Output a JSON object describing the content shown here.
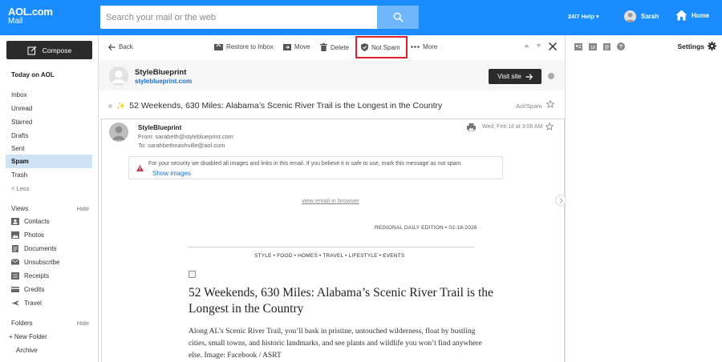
{
  "brand": {
    "logo_main": "AOL.com",
    "logo_sub": "Mail"
  },
  "search": {
    "placeholder": "Search your mail or the web"
  },
  "header": {
    "help": "24/7 Help ▾",
    "user_name": "Sarah",
    "home": "Home"
  },
  "sidebar": {
    "compose": "Compose",
    "today": "Today on AOL",
    "folders": [
      {
        "label": "Inbox",
        "active": false
      },
      {
        "label": "Unread",
        "active": false
      },
      {
        "label": "Starred",
        "active": false
      },
      {
        "label": "Drafts",
        "active": false
      },
      {
        "label": "Sent",
        "active": false
      },
      {
        "label": "Spam",
        "active": true
      },
      {
        "label": "Trash",
        "active": false
      }
    ],
    "less": "˄ Less",
    "views_head": "Views",
    "views_hide": "Hide",
    "views": [
      {
        "label": "Contacts",
        "icon": "contacts-icon"
      },
      {
        "label": "Photos",
        "icon": "photos-icon"
      },
      {
        "label": "Documents",
        "icon": "documents-icon"
      },
      {
        "label": "Unsubscribe",
        "icon": "unsubscribe-icon"
      },
      {
        "label": "Receipts",
        "icon": "receipts-icon"
      },
      {
        "label": "Credits",
        "icon": "credits-icon"
      },
      {
        "label": "Travel",
        "icon": "travel-icon"
      }
    ],
    "folders_head": "Folders",
    "folders_hide": "Hide",
    "new_folder": "+ New Folder",
    "archive": "Archive"
  },
  "toolbar": {
    "back": "Back",
    "restore": "Restore to Inbox",
    "move": "Move",
    "delete": "Delete",
    "not_spam": "Not Spam",
    "more": "More"
  },
  "sender": {
    "name": "StyleBlueprint",
    "site": "styleblueprint.com",
    "visit": "Visit site"
  },
  "subject": {
    "text": "52 Weekends, 630 Miles: Alabama’s Scenic River Trail is the Longest in the Country",
    "folder": "Aol/Spam"
  },
  "message": {
    "from_name": "StyleBlueprint",
    "from_line": "From: sarabeth@styleblueprint.com",
    "to_line": "To: sarahbethnashville@aol.com",
    "date": "Wed, Feb 18 at 3:08 AM",
    "security_text": "For your security we disabled all images and links in this email. If you believe it is safe to use, mark this message as not spam.",
    "show_images": "Show images",
    "view_web": "view email in browser",
    "edition": "REGIONAL DAILY EDITION • 02-18-2026",
    "categories": "STYLE • FOOD • HOMES • TRAVEL • LIFESTYLE • EVENTS",
    "headline": "52 Weekends, 630 Miles: Alabama’s Scenic River Trail is the Longest in the Country",
    "body": "Along AL’s Scenic River Trail, you’ll bask in pristine, untouched wilderness, float by bustling cities, small towns, and historic landmarks, and see plants and wildlife you won’t find anywhere else. Image: Facebook / ASRT"
  },
  "right_panel": {
    "settings": "Settings"
  },
  "colors": {
    "brand_blue": "#1a8cff",
    "highlight_red": "#e0202a",
    "active_folder": "#cfe3f6",
    "link_blue": "#1a6fd6"
  }
}
